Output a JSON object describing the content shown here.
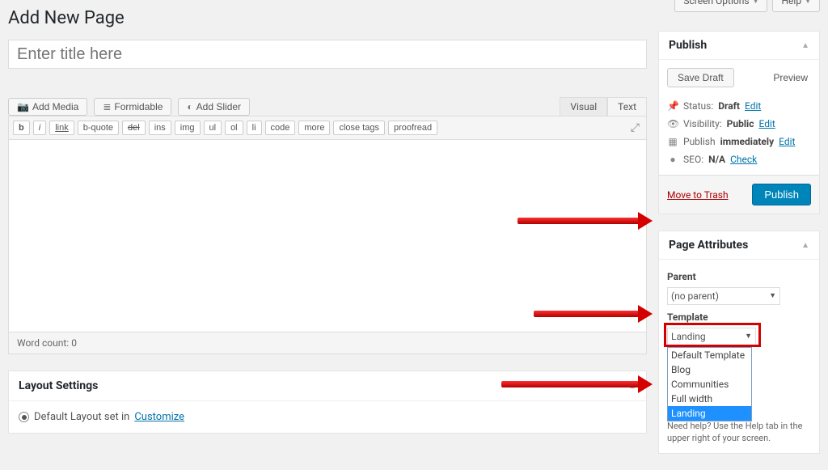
{
  "top": {
    "screen_options": "Screen Options",
    "help": "Help"
  },
  "page_title": "Add New Page",
  "title_placeholder": "Enter title here",
  "media": {
    "add_media": "Add Media",
    "formidable": "Formidable",
    "add_slider": "Add Slider"
  },
  "editor_tabs": {
    "visual": "Visual",
    "text": "Text"
  },
  "toolbar": [
    "b",
    "i",
    "link",
    "b-quote",
    "del",
    "ins",
    "img",
    "ul",
    "ol",
    "li",
    "code",
    "more",
    "close tags",
    "proofread"
  ],
  "editor_footer": {
    "wc_label": "Word count:",
    "wc": "0"
  },
  "layout": {
    "title": "Layout Settings",
    "default_label": "Default Layout set in ",
    "customize": "Customize"
  },
  "publish": {
    "title": "Publish",
    "save_draft": "Save Draft",
    "preview": "Preview",
    "status_label": "Status:",
    "status": "Draft",
    "edit": "Edit",
    "visibility_label": "Visibility:",
    "visibility": "Public",
    "publish_label": "Publish",
    "immediately": "immediately",
    "seo_label": "SEO:",
    "seo": "N/A",
    "check": "Check",
    "trash": "Move to Trash",
    "publish_btn": "Publish"
  },
  "attrs": {
    "title": "Page Attributes",
    "parent_label": "Parent",
    "parent_value": "(no parent)",
    "template_label": "Template",
    "template_value": "Landing",
    "options": [
      "Default Template",
      "Blog",
      "Communities",
      "Full width",
      "Landing"
    ],
    "help": "Need help? Use the Help tab in the upper right of your screen."
  }
}
